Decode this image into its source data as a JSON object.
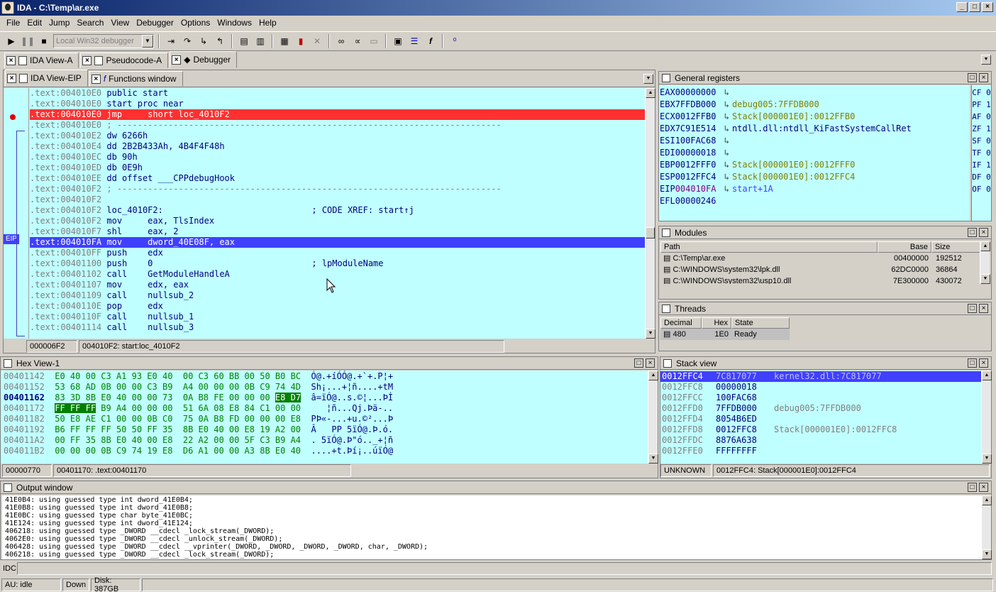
{
  "window": {
    "title": "IDA - C:\\Temp\\ar.exe",
    "buttons": [
      "_",
      "□",
      "×"
    ]
  },
  "menu": [
    "File",
    "Edit",
    "Jump",
    "Search",
    "View",
    "Debugger",
    "Options",
    "Windows",
    "Help"
  ],
  "toolbar": {
    "debugger_select": "Local Win32 debugger"
  },
  "main_tabs": [
    {
      "label": "IDA View-A"
    },
    {
      "label": "Pseudocode-A"
    },
    {
      "label": "Debugger"
    }
  ],
  "sub_tabs": [
    {
      "label": "IDA View-EIP"
    },
    {
      "label": "Functions window"
    }
  ],
  "disasm": {
    "eip_marker": "EIP",
    "lines": [
      {
        "addr": ".text:004010E0",
        "text": " public start",
        "style": ""
      },
      {
        "addr": ".text:004010E0",
        "text": " start proc near",
        "style": ""
      },
      {
        "addr": ".text:004010E0",
        "text": " jmp     short loc_4010F2",
        "style": "bp"
      },
      {
        "addr": ".text:004010E0",
        "text": " ; ---------------------------------------------------------------------------",
        "style": "sep"
      },
      {
        "addr": ".text:004010E2",
        "text": " dw 6266h",
        "style": ""
      },
      {
        "addr": ".text:004010E4",
        "text": " dd 2B2B433Ah, 4B4F4F48h",
        "style": ""
      },
      {
        "addr": ".text:004010EC",
        "text": " db 90h",
        "style": ""
      },
      {
        "addr": ".text:004010ED",
        "text": " db 0E9h",
        "style": ""
      },
      {
        "addr": ".text:004010EE",
        "text": " dd offset ___CPPdebugHook",
        "style": ""
      },
      {
        "addr": ".text:004010F2",
        "text": " ; ---------------------------------------------------------------------------",
        "style": "sep"
      },
      {
        "addr": ".text:004010F2",
        "text": "",
        "style": ""
      },
      {
        "addr": ".text:004010F2",
        "text": " loc_4010F2:                             ; CODE XREF: start↑j",
        "style": "xref"
      },
      {
        "addr": ".text:004010F2",
        "text": " mov     eax, TlsIndex",
        "style": ""
      },
      {
        "addr": ".text:004010F7",
        "text": " shl     eax, 2",
        "style": ""
      },
      {
        "addr": ".text:004010FA",
        "text": " mov     dword_40E08F, eax",
        "style": "eip"
      },
      {
        "addr": ".text:004010FF",
        "text": " push    edx",
        "style": ""
      },
      {
        "addr": ".text:00401100",
        "text": " push    0                               ; lpModuleName",
        "style": "cmt2"
      },
      {
        "addr": ".text:00401102",
        "text": " call    GetModuleHandleA",
        "style": ""
      },
      {
        "addr": ".text:00401107",
        "text": " mov     edx, eax",
        "style": ""
      },
      {
        "addr": ".text:00401109",
        "text": " call    nullsub_2",
        "style": ""
      },
      {
        "addr": ".text:0040110E",
        "text": " pop     edx",
        "style": ""
      },
      {
        "addr": ".text:0040110F",
        "text": " call    nullsub_1",
        "style": ""
      },
      {
        "addr": ".text:00401114",
        "text": " call    nullsub_3",
        "style": ""
      }
    ],
    "status": [
      "000006F2",
      "004010F2: start:loc_4010F2"
    ]
  },
  "registers": {
    "title": "General registers",
    "rows": [
      {
        "name": "EAX",
        "val": "00000000",
        "ref": ""
      },
      {
        "name": "EBX",
        "val": "7FFDB000",
        "ref": "debug005:7FFDB000"
      },
      {
        "name": "ECX",
        "val": "0012FFB0",
        "ref": "Stack[000001E0]:0012FFB0"
      },
      {
        "name": "EDX",
        "val": "7C91E514",
        "ref": "ntdll.dll:ntdll_KiFastSystemCallRet"
      },
      {
        "name": "ESI",
        "val": "100FAC68",
        "ref": ""
      },
      {
        "name": "EDI",
        "val": "00000018",
        "ref": ""
      },
      {
        "name": "EBP",
        "val": "0012FFF0",
        "ref": "Stack[000001E0]:0012FFF0"
      },
      {
        "name": "ESP",
        "val": "0012FFC4",
        "ref": "Stack[000001E0]:0012FFC4"
      },
      {
        "name": "EIP",
        "val": "004010FA",
        "ref": "start+1A"
      },
      {
        "name": "EFL",
        "val": "00000246",
        "ref": ""
      }
    ],
    "flags": [
      "CF 0",
      "PF 1",
      "AF 0",
      "ZF 1",
      "SF 0",
      "TF 0",
      "IF 1",
      "DF 0",
      "OF 0"
    ]
  },
  "modules": {
    "title": "Modules",
    "headers": [
      "Path",
      "Base",
      "Size"
    ],
    "rows": [
      {
        "path": "C:\\Temp\\ar.exe",
        "base": "00400000",
        "size": "192512"
      },
      {
        "path": "C:\\WINDOWS\\system32\\lpk.dll",
        "base": "62DC0000",
        "size": "36864"
      },
      {
        "path": "C:\\WINDOWS\\system32\\usp10.dll",
        "base": "7E300000",
        "size": "430072"
      }
    ]
  },
  "threads": {
    "title": "Threads",
    "headers": [
      "Decimal",
      "Hex",
      "State"
    ],
    "rows": [
      {
        "dec": "480",
        "hex": "1E0",
        "state": "Ready"
      }
    ]
  },
  "hex": {
    "title": "Hex View-1",
    "rows": [
      {
        "addr": "00401142",
        "bytes": "E0 40 00 C3 A1 93 E0 40  00 C3 60 BB 00 50 B0 BC",
        "ascii": "Ó@.+íÓÓ@.+`+.P¦+"
      },
      {
        "addr": "00401152",
        "bytes": "53 68 AD 0B 00 00 C3 B9  A4 00 00 00 0B C9 74 4D",
        "ascii": "Sh¡...+¦ñ....+tM"
      },
      {
        "addr": "00401162",
        "bytes": "83 3D 8B E0 40 00 00 73  0A B8 FE 00 00 00 ",
        "hl": "E8 D7",
        "ascii": "â=ïÓ@..s.©¦...Þİ"
      },
      {
        "addr": "00401172",
        "pre": "FF FF FF",
        "bytes": " B9 A4 00 00 00  51 6A 08 E8 84 C1 00 00",
        "ascii": "   ¦ñ...Qj.Þä-.."
      },
      {
        "addr": "00401182",
        "bytes": "50 E8 AE C1 00 00 0B C0  75 0A B8 FD 00 00 00 E8",
        "ascii": "PÞ«-...+u.©²...Þ"
      },
      {
        "addr": "00401192",
        "bytes": "B6 FF FF FF 50 50 FF 35  8B E0 40 00 E8 19 A2 00",
        "ascii": "Â   PP 5ïÓ@.Þ.ó."
      },
      {
        "addr": "004011A2",
        "bytes": "00 FF 35 8B E0 40 00 E8  22 A2 00 00 5F C3 B9 A4",
        "ascii": ". 5ïÓ@.Þ\"ó.._+¦ñ"
      },
      {
        "addr": "004011B2",
        "bytes": "00 00 00 0B C9 74 19 E8  D6 A1 00 00 A3 8B E0 40",
        "ascii": "....+t.Þí¡..úïÓ@"
      }
    ],
    "status": [
      "00000770",
      "00401170: .text:00401170"
    ]
  },
  "stack": {
    "title": "Stack view",
    "rows": [
      {
        "addr": "0012FFC4",
        "val": "7C817077",
        "ref": "kernel32.dll:7C817077"
      },
      {
        "addr": "0012FFC8",
        "val": "00000018",
        "ref": ""
      },
      {
        "addr": "0012FFCC",
        "val": "100FAC68",
        "ref": ""
      },
      {
        "addr": "0012FFD0",
        "val": "7FFDB000",
        "ref": "debug005:7FFDB000"
      },
      {
        "addr": "0012FFD4",
        "val": "8054B6ED",
        "ref": ""
      },
      {
        "addr": "0012FFD8",
        "val": "0012FFC8",
        "ref": "Stack[000001E0]:0012FFC8"
      },
      {
        "addr": "0012FFDC",
        "val": "8876A638",
        "ref": ""
      },
      {
        "addr": "0012FFE0",
        "val": "FFFFFFFF",
        "ref": ""
      }
    ],
    "status": [
      "UNKNOWN",
      "0012FFC4: Stack[000001E0]:0012FFC4"
    ]
  },
  "output": {
    "title": "Output window",
    "lines": [
      "41E0B4: using guessed type int dword_41E0B4;",
      "41E0B8: using guessed type int dword_41E0B8;",
      "41E0BC: using guessed type char byte_41E0BC;",
      "41E124: using guessed type int dword_41E124;",
      "406218: using guessed type _DWORD __cdecl _lock_stream(_DWORD);",
      "4062E0: using guessed type _DWORD __cdecl _unlock_stream(_DWORD);",
      "406428: using guessed type _DWORD __cdecl __vprinter(_DWORD, _DWORD, _DWORD, _DWORD, char, _DWORD);",
      "406218: using guessed type _DWORD __cdecl _lock_stream(_DWORD);"
    ]
  },
  "idc": {
    "label": "IDC",
    "value": ""
  },
  "statusbar": {
    "au": "AU:  idle",
    "dir": "Down",
    "disk": "Disk: 387GB"
  }
}
